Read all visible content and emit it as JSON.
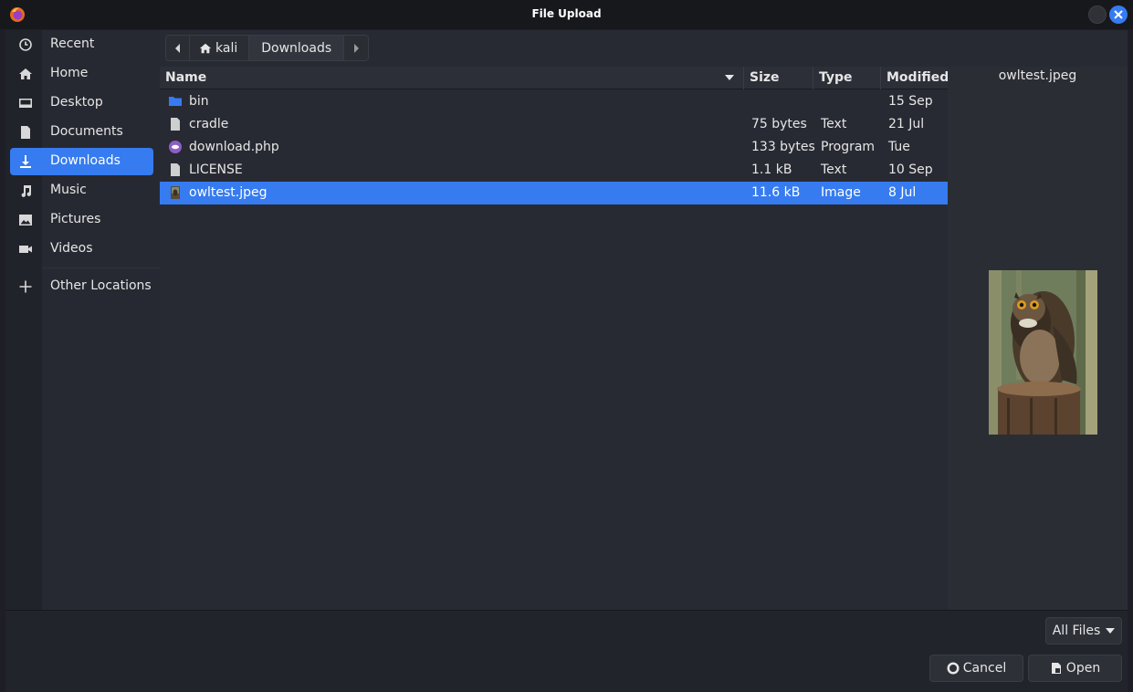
{
  "window": {
    "title": "File Upload"
  },
  "sidebar": {
    "items": [
      {
        "label": "Recent",
        "icon": "clock-icon"
      },
      {
        "label": "Home",
        "icon": "home-icon"
      },
      {
        "label": "Desktop",
        "icon": "desktop-icon"
      },
      {
        "label": "Documents",
        "icon": "document-icon"
      },
      {
        "label": "Downloads",
        "icon": "download-icon",
        "active": true
      },
      {
        "label": "Music",
        "icon": "music-icon"
      },
      {
        "label": "Pictures",
        "icon": "picture-icon"
      },
      {
        "label": "Videos",
        "icon": "video-icon"
      },
      {
        "label": "Other Locations",
        "icon": "plus-icon"
      }
    ]
  },
  "pathbar": {
    "home": "kali",
    "current": "Downloads"
  },
  "columns": {
    "name": "Name",
    "size": "Size",
    "type": "Type",
    "modified": "Modified"
  },
  "files": [
    {
      "name": "bin",
      "size": "",
      "type": "",
      "modified": "15 Sep",
      "icon": "folder-icon"
    },
    {
      "name": "cradle",
      "size": "75 bytes",
      "type": "Text",
      "modified": "21 Jul",
      "icon": "text-file-icon"
    },
    {
      "name": "download.php",
      "size": "133 bytes",
      "type": "Program",
      "modified": "Tue",
      "icon": "php-file-icon"
    },
    {
      "name": "LICENSE",
      "size": "1.1 kB",
      "type": "Text",
      "modified": "10 Sep",
      "icon": "text-file-icon"
    },
    {
      "name": "owltest.jpeg",
      "size": "11.6 kB",
      "type": "Image",
      "modified": "8 Jul",
      "icon": "image-file-icon",
      "selected": true
    }
  ],
  "preview": {
    "filename": "owltest.jpeg"
  },
  "filter": {
    "label": "All Files"
  },
  "actions": {
    "cancel": "Cancel",
    "open": "Open"
  },
  "colors": {
    "accent": "#367bf0",
    "background": "#282a33",
    "sidebar": "#272932"
  }
}
